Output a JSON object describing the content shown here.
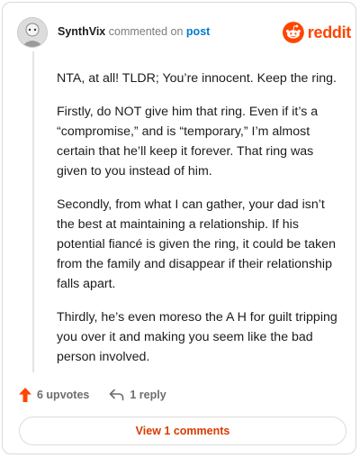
{
  "comment": {
    "author": "SynthVix",
    "action_text": "commented on",
    "post_link": "post",
    "paragraphs": [
      "NTA, at all! TLDR; You’re innocent. Keep the ring.",
      "Firstly, do NOT give him that ring. Even if it’s a “compromise,” and is “temporary,” I’m almost certain that he’ll keep it forever. That ring was given to you instead of him.",
      "Secondly, from what I can gather, your dad isn’t the best at maintaining a relationship. If his potential fiancé is given the ring, it could be taken from the family and disappear if their relationship falls apart.",
      "Thirdly, he’s even moreso the A H for guilt tripping you over it and making you seem like the bad person involved."
    ]
  },
  "brand": {
    "wordmark": "reddit",
    "color": "#ff4500",
    "icon": "reddit-snoo-icon"
  },
  "actions": {
    "upvotes_label": "6 upvotes",
    "upvote_icon": "upvote-arrow-icon",
    "upvote_color": "#ff4500",
    "reply_label": "1 reply",
    "reply_icon": "reply-arrow-icon"
  },
  "view_comments_label": "View 1 comments",
  "accent_color": "#d93a00"
}
